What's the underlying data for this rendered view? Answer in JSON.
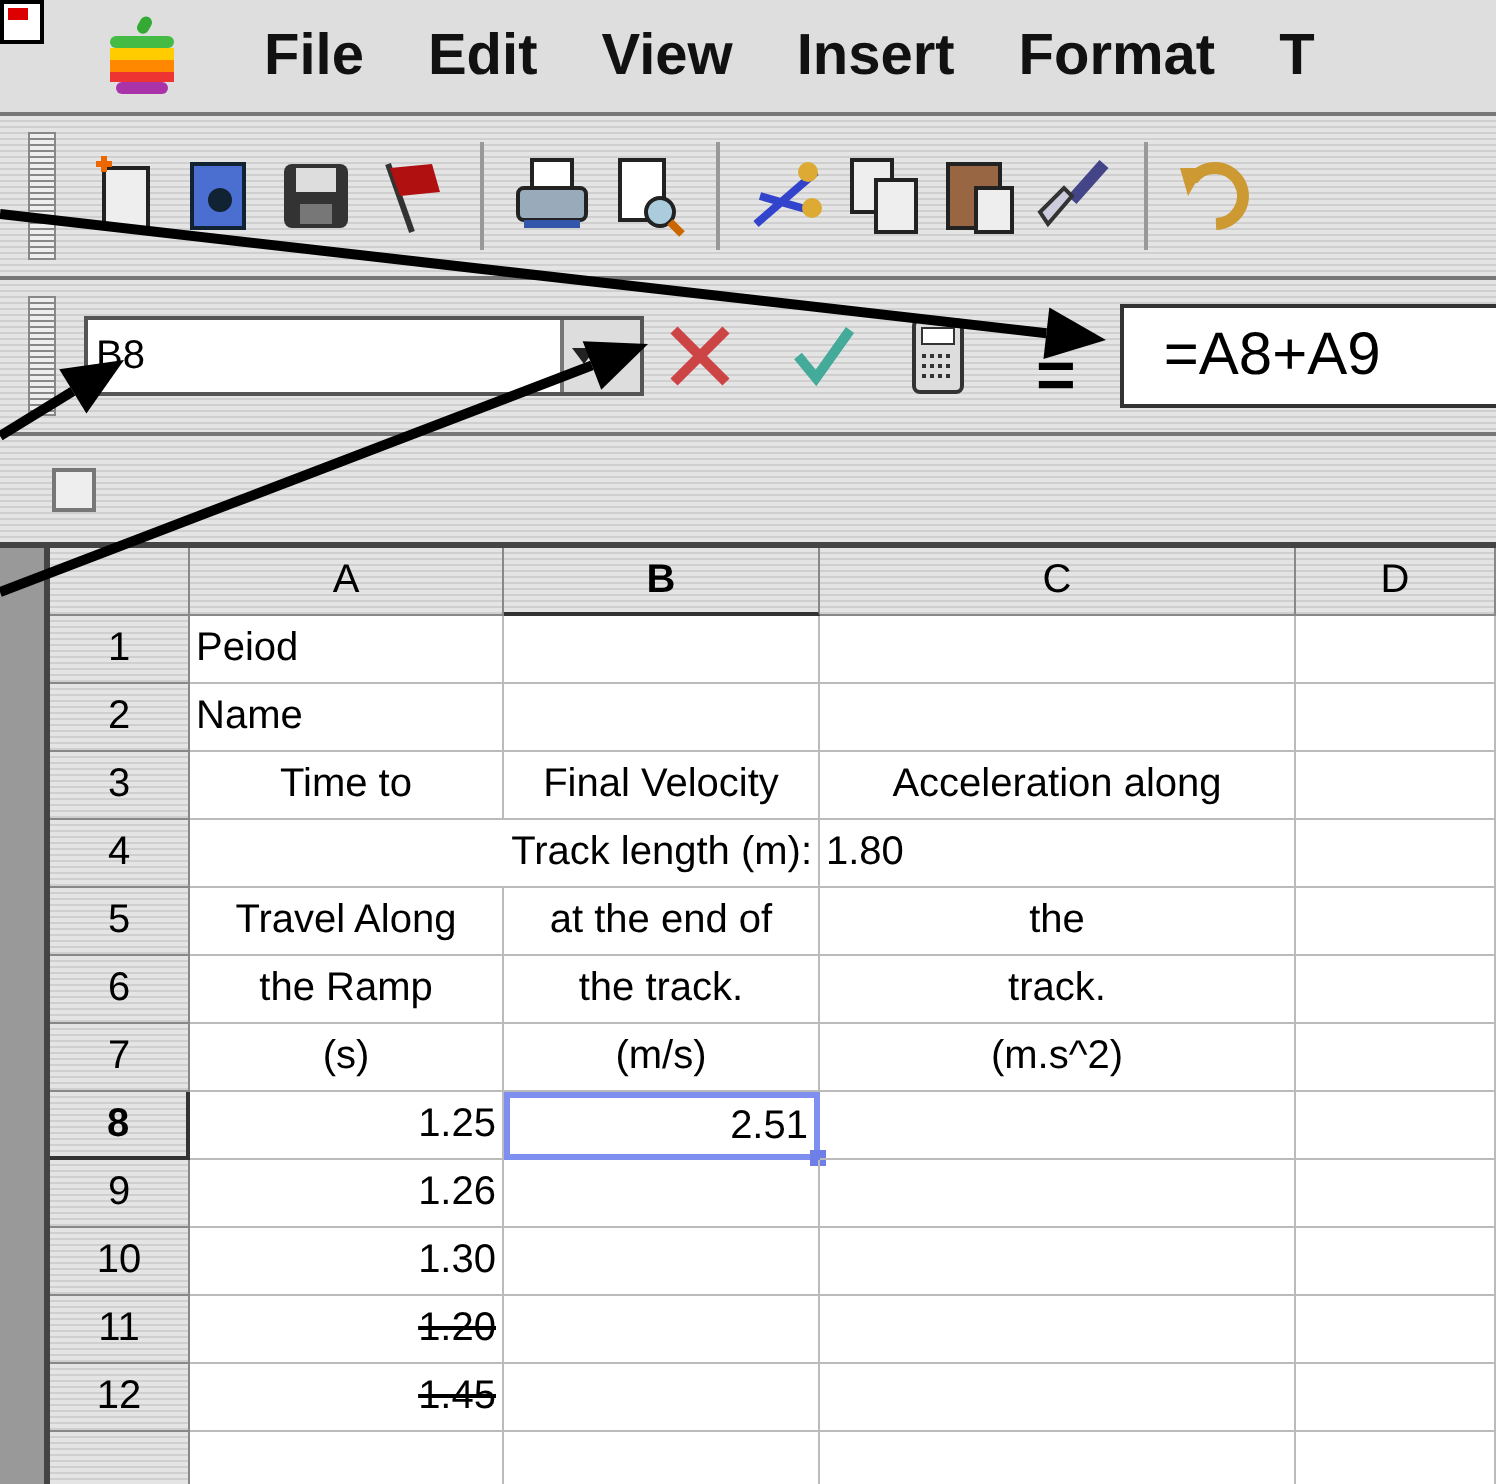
{
  "menu_bar": {
    "items": [
      "File",
      "Edit",
      "View",
      "Insert",
      "Format",
      "T"
    ]
  },
  "formula_bar": {
    "name_box": "B8",
    "equals_button": "=",
    "formula": "=A8+A9"
  },
  "sheet": {
    "columns": [
      {
        "label": "A",
        "selected": false
      },
      {
        "label": "B",
        "selected": true
      },
      {
        "label": "C",
        "selected": false
      },
      {
        "label": "D",
        "selected": false
      }
    ],
    "rows": [
      {
        "header": "1",
        "selected": false,
        "a": {
          "text": "Peiod",
          "kind": "left",
          "struck": false,
          "selected": false
        }
      },
      {
        "header": "2",
        "selected": false,
        "a": {
          "text": "Name",
          "kind": "left",
          "struck": false,
          "selected": false
        }
      },
      {
        "header": "3",
        "selected": false,
        "a": {
          "text": "Time to",
          "kind": "center",
          "struck": false,
          "selected": false
        },
        "b": {
          "text": "Final Velocity",
          "kind": "center",
          "struck": false,
          "selected": false
        },
        "c": {
          "text": "Acceleration along",
          "kind": "center",
          "struck": false,
          "selected": false
        }
      },
      {
        "header": "4",
        "selected": false,
        "b": {
          "text": "Track length (m):",
          "kind": "spill",
          "struck": false,
          "selected": false
        },
        "c": {
          "text": "1.80",
          "kind": "left",
          "struck": false,
          "selected": false
        }
      },
      {
        "header": "5",
        "selected": false,
        "a": {
          "text": "Travel Along",
          "kind": "center",
          "struck": false,
          "selected": false
        },
        "b": {
          "text": "at the end of",
          "kind": "center",
          "struck": false,
          "selected": false
        },
        "c": {
          "text": "the",
          "kind": "center",
          "struck": false,
          "selected": false
        }
      },
      {
        "header": "6",
        "selected": false,
        "a": {
          "text": "the Ramp",
          "kind": "center",
          "struck": false,
          "selected": false
        },
        "b": {
          "text": "the track.",
          "kind": "center",
          "struck": false,
          "selected": false
        },
        "c": {
          "text": "track.",
          "kind": "center",
          "struck": false,
          "selected": false
        }
      },
      {
        "header": "7",
        "selected": false,
        "a": {
          "text": "(s)",
          "kind": "center",
          "struck": false,
          "selected": false
        },
        "b": {
          "text": "(m/s)",
          "kind": "center",
          "struck": false,
          "selected": false
        },
        "c": {
          "text": "(m.s^2)",
          "kind": "center",
          "struck": false,
          "selected": false
        }
      },
      {
        "header": "8",
        "selected": true,
        "a": {
          "text": "1.25",
          "kind": "right",
          "struck": false,
          "selected": false
        },
        "b": {
          "text": "2.51",
          "kind": "right",
          "struck": false,
          "selected": true
        }
      },
      {
        "header": "9",
        "selected": false,
        "a": {
          "text": "1.26",
          "kind": "right",
          "struck": false,
          "selected": false
        }
      },
      {
        "header": "10",
        "selected": false,
        "a": {
          "text": "1.30",
          "kind": "right",
          "struck": false,
          "selected": false
        }
      },
      {
        "header": "11",
        "selected": false,
        "a": {
          "text": "1.20",
          "kind": "right",
          "struck": true,
          "selected": false
        }
      },
      {
        "header": "12",
        "selected": false,
        "a": {
          "text": "1.45",
          "kind": "right",
          "struck": true,
          "selected": false
        }
      }
    ]
  }
}
